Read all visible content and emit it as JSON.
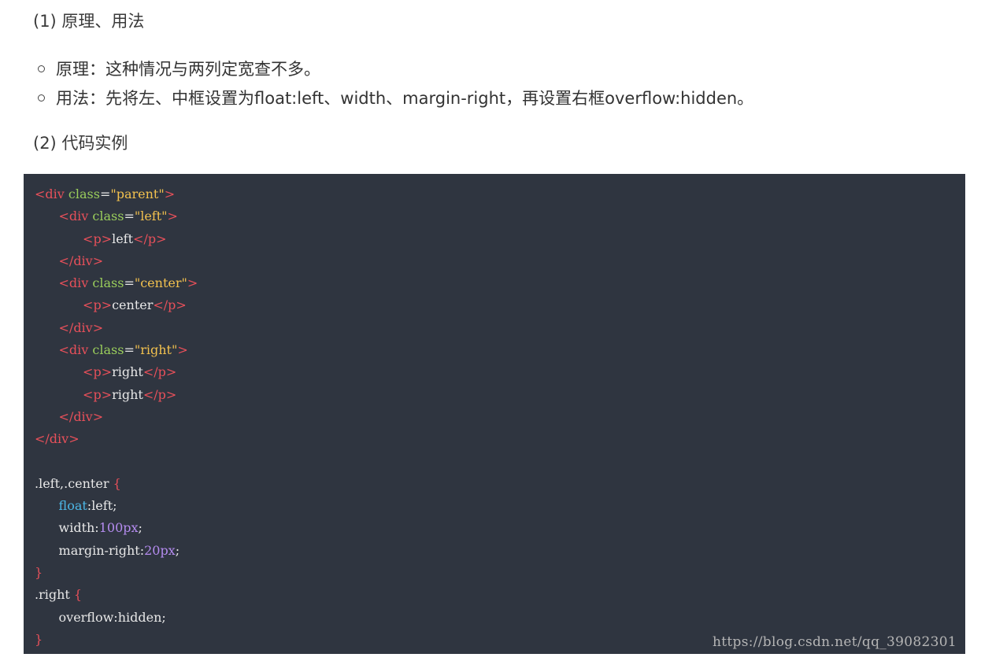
{
  "section1_title": "(1) 原理、用法",
  "bullets": [
    "原理：这种情况与两列定宽查不多。",
    "用法：先将左、中框设置为float:left、width、margin-right，再设置右框overflow:hidden。"
  ],
  "section2_title": "(2) 代码实例",
  "code_lines": [
    [
      [
        "tag",
        "<div "
      ],
      [
        "attr",
        "class"
      ],
      [
        "txt",
        "="
      ],
      [
        "str",
        "\"parent\""
      ],
      [
        "tag",
        ">"
      ]
    ],
    [
      [
        "txt",
        "      "
      ],
      [
        "tag",
        "<div "
      ],
      [
        "attr",
        "class"
      ],
      [
        "txt",
        "="
      ],
      [
        "str",
        "\"left\""
      ],
      [
        "tag",
        ">"
      ]
    ],
    [
      [
        "txt",
        "            "
      ],
      [
        "tag",
        "<p>"
      ],
      [
        "txt",
        "left"
      ],
      [
        "tag",
        "</p>"
      ]
    ],
    [
      [
        "txt",
        "      "
      ],
      [
        "tag",
        "</div>"
      ]
    ],
    [
      [
        "txt",
        "      "
      ],
      [
        "tag",
        "<div "
      ],
      [
        "attr",
        "class"
      ],
      [
        "txt",
        "="
      ],
      [
        "str",
        "\"center\""
      ],
      [
        "tag",
        ">"
      ]
    ],
    [
      [
        "txt",
        "            "
      ],
      [
        "tag",
        "<p>"
      ],
      [
        "txt",
        "center"
      ],
      [
        "tag",
        "</p>"
      ]
    ],
    [
      [
        "txt",
        "      "
      ],
      [
        "tag",
        "</div>"
      ]
    ],
    [
      [
        "txt",
        "      "
      ],
      [
        "tag",
        "<div "
      ],
      [
        "attr",
        "class"
      ],
      [
        "txt",
        "="
      ],
      [
        "str",
        "\"right\""
      ],
      [
        "tag",
        ">"
      ]
    ],
    [
      [
        "txt",
        "            "
      ],
      [
        "tag",
        "<p>"
      ],
      [
        "txt",
        "right"
      ],
      [
        "tag",
        "</p>"
      ]
    ],
    [
      [
        "txt",
        "            "
      ],
      [
        "tag",
        "<p>"
      ],
      [
        "txt",
        "right"
      ],
      [
        "tag",
        "</p>"
      ]
    ],
    [
      [
        "txt",
        "      "
      ],
      [
        "tag",
        "</div>"
      ]
    ],
    [
      [
        "tag",
        "</div>"
      ]
    ],
    [
      [
        "txt",
        ""
      ]
    ],
    [
      [
        "txt",
        ".left,.center "
      ],
      [
        "tag",
        "{"
      ]
    ],
    [
      [
        "txt",
        "      "
      ],
      [
        "prop",
        "float"
      ],
      [
        "txt",
        ":left;"
      ]
    ],
    [
      [
        "txt",
        "      width:"
      ],
      [
        "num",
        "100px"
      ],
      [
        "txt",
        ";"
      ]
    ],
    [
      [
        "txt",
        "      margin-right:"
      ],
      [
        "num",
        "20px"
      ],
      [
        "txt",
        ";"
      ]
    ],
    [
      [
        "tag",
        "}"
      ]
    ],
    [
      [
        "txt",
        ".right "
      ],
      [
        "tag",
        "{"
      ]
    ],
    [
      [
        "txt",
        "      overflow:hidden;"
      ]
    ],
    [
      [
        "tag",
        "}"
      ]
    ]
  ],
  "watermark": "https://blog.csdn.net/qq_39082301"
}
